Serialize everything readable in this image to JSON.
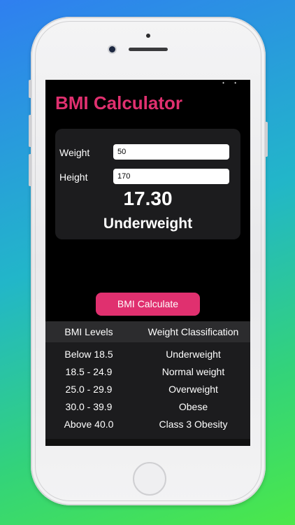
{
  "app": {
    "title": "BMI Calculator"
  },
  "form": {
    "weight_label": "Weight",
    "weight_value": "50",
    "height_label": "Height",
    "height_value": "170"
  },
  "result": {
    "bmi": "17.30",
    "classification": "Underweight"
  },
  "actions": {
    "calculate_label": "BMI Calculate"
  },
  "table": {
    "headers": [
      "BMI Levels",
      "Weight Classification"
    ],
    "rows": [
      {
        "level": "Below 18.5",
        "classification": "Underweight"
      },
      {
        "level": "18.5 - 24.9",
        "classification": "Normal weight"
      },
      {
        "level": "25.0 - 29.9",
        "classification": "Overweight"
      },
      {
        "level": "30.0 - 39.9",
        "classification": "Obese"
      },
      {
        "level": "Above 40.0",
        "classification": "Class 3 Obesity"
      }
    ]
  },
  "colors": {
    "accent": "#e0306f",
    "background": "#000000",
    "card": "#1c1c1e",
    "table_header": "#2c2c2e"
  }
}
